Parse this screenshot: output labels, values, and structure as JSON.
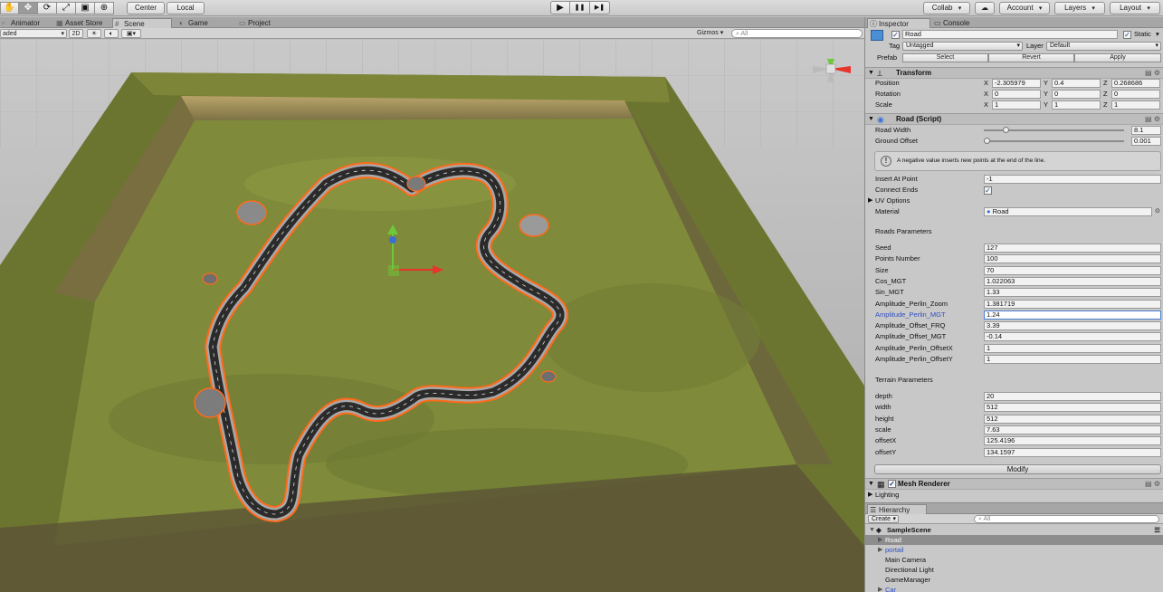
{
  "toolbar": {
    "tools": [
      "hand-tool",
      "move-tool",
      "rotate-tool",
      "scale-tool",
      "rect-tool",
      "transform-tool"
    ],
    "pivot_label": "Center",
    "space_label": "Local",
    "play_label": "▶",
    "pause_label": "❚❚",
    "step_label": "▶❚",
    "collab_label": "Collab",
    "cloud_icon": "cloud-icon",
    "account_label": "Account",
    "layers_label": "Layers",
    "layout_label": "Layout"
  },
  "tabs": {
    "animator": "Animator",
    "asset_store": "Asset Store",
    "scene": "Scene",
    "game": "Game",
    "project": "Project"
  },
  "scenebar": {
    "shading_mode": "aded",
    "mode_2d": "2D",
    "gizmos_label": "Gizmos",
    "search_placeholder": "All"
  },
  "inspector": {
    "tab_inspector": "Inspector",
    "tab_console": "Console",
    "object_name": "Road",
    "static_label": "Static",
    "tag_label": "Tag",
    "tag_value": "Untagged",
    "layer_label": "Layer",
    "layer_value": "Default",
    "prefab_label": "Prefab",
    "prefab_select": "Select",
    "prefab_revert": "Revert",
    "prefab_apply": "Apply",
    "transform": {
      "title": "Transform",
      "position_label": "Position",
      "rotation_label": "Rotation",
      "scale_label": "Scale",
      "position": {
        "x": "-2.305979",
        "y": "0.4",
        "z": "0.268686"
      },
      "rotation": {
        "x": "0",
        "y": "0",
        "z": "0"
      },
      "scale": {
        "x": "1",
        "y": "1",
        "z": "1"
      }
    },
    "road_script": {
      "title": "Road (Script)",
      "road_width_label": "Road Width",
      "road_width": "8.1",
      "road_width_fraction": 0.14,
      "ground_offset_label": "Ground Offset",
      "ground_offset": "0.001",
      "ground_offset_fraction": 0.0,
      "help_text": "A negative value inserts new points at the end of the line.",
      "insert_at_point_label": "Insert At Point",
      "insert_at_point": "-1",
      "connect_ends_label": "Connect Ends",
      "connect_ends": true,
      "uv_options_label": "UV Options",
      "material_label": "Material",
      "material_value": "Road",
      "roads_parameters_label": "Roads Parameters",
      "terrain_parameters_label": "Terrain Parameters",
      "road_params": [
        {
          "label": "Seed",
          "value": "127"
        },
        {
          "label": "Points Number",
          "value": "100"
        },
        {
          "label": "Size",
          "value": "70"
        },
        {
          "label": "Cos_MGT",
          "value": "1.022063"
        },
        {
          "label": "Sin_MGT",
          "value": "1.33"
        },
        {
          "label": "Amplitude_Perlin_Zoom",
          "value": "1.381719"
        },
        {
          "label": "Amplitude_Perlin_MGT",
          "value": "1.24"
        },
        {
          "label": "Amplitude_Offset_FRQ",
          "value": "3.39"
        },
        {
          "label": "Amplitude_Offset_MGT",
          "value": "-0.14"
        },
        {
          "label": "Amplitude_Perlin_OffsetX",
          "value": "1"
        },
        {
          "label": "Amplitude_Perlin_OffsetY",
          "value": "1"
        }
      ],
      "terrain_params": [
        {
          "label": "depth",
          "value": "20"
        },
        {
          "label": "width",
          "value": "512"
        },
        {
          "label": "height",
          "value": "512"
        },
        {
          "label": "scale",
          "value": "7.63"
        },
        {
          "label": "offsetX",
          "value": "125.4196"
        },
        {
          "label": "offsetY",
          "value": "134.1597"
        }
      ],
      "modify_label": "Modify"
    },
    "mesh_renderer": {
      "title": "Mesh Renderer",
      "lighting_label": "Lighting"
    }
  },
  "hierarchy": {
    "tab_label": "Hierarchy",
    "create_label": "Create",
    "search_placeholder": "All",
    "scene_name": "SampleScene",
    "items": [
      {
        "label": "Road",
        "selected": true,
        "expandable": true,
        "prefab": true
      },
      {
        "label": "portail",
        "selected": false,
        "expandable": true,
        "prefab": true
      },
      {
        "label": "Main Camera",
        "selected": false,
        "expandable": false,
        "prefab": false
      },
      {
        "label": "Directional Light",
        "selected": false,
        "expandable": false,
        "prefab": false
      },
      {
        "label": "GameManager",
        "selected": false,
        "expandable": false,
        "prefab": false
      },
      {
        "label": "Car",
        "selected": false,
        "expandable": true,
        "prefab": true
      }
    ]
  },
  "colors": {
    "terrain_light": "#7f8a3a",
    "terrain_dark": "#5f6a2a",
    "road": "#2b2b2b",
    "road_border": "#a8a8a8",
    "selection_outline": "#ff6a1a",
    "sky": "#b5b5b5",
    "gizmo_x": "#e8352b",
    "gizmo_y": "#6cc93a",
    "gizmo_z": "#3a6fd8"
  }
}
